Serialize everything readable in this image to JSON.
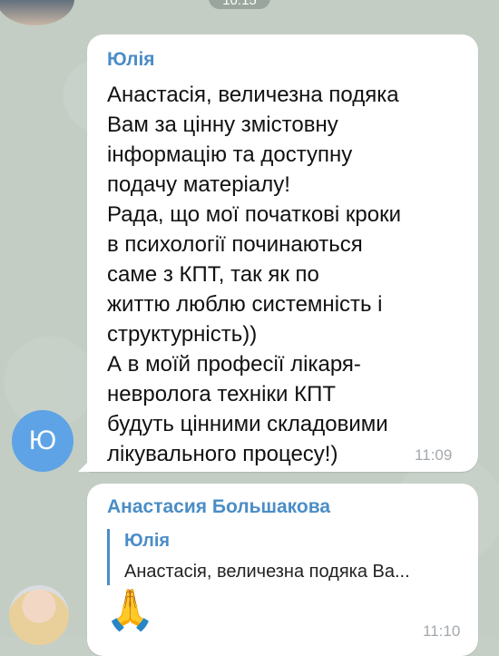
{
  "date_pill": {
    "label": "10:15"
  },
  "messages": [
    {
      "sender": "Юлія",
      "avatar_letter": "Ю",
      "text": "Анастасія, величезна подяка\nВам за цінну змістовну\nінформацію та доступну\nподачу матеріалу!\nРада, що мої початкові кроки\nв психології починаються\nсаме з КПТ, так як по\nжиттю люблю системність і\nструктурність))\nА в моїй професії лікаря-\nневролога техніки КПТ\nбудуть цінними складовими\nлікувального процесу!)",
      "time": "11:09"
    },
    {
      "sender": "Анастасия Большакова",
      "reply": {
        "name": "Юлія",
        "text": "Анастасія, величезна подяка Ва..."
      },
      "emoji": "🙏",
      "time": "11:10"
    }
  ]
}
